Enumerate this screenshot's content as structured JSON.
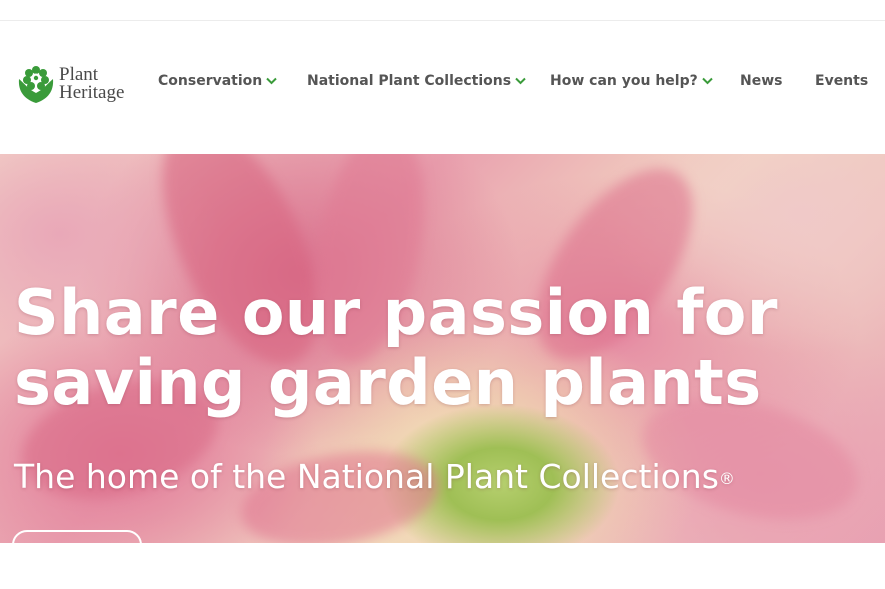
{
  "brand": {
    "name_line1": "Plant",
    "name_line2": "Heritage",
    "green": "#3a9b3a",
    "logo_icon": "flower-hands-icon"
  },
  "nav": {
    "items": [
      {
        "label": "Conservation",
        "has_dropdown": true
      },
      {
        "label": "National Plant Collections",
        "has_dropdown": true
      },
      {
        "label": "How can you help?",
        "has_dropdown": true
      },
      {
        "label": "News",
        "has_dropdown": false
      },
      {
        "label": "Events",
        "has_dropdown": false
      }
    ],
    "dropdown_icon": "chevron-down-icon",
    "chevron_color": "#3a9b3a"
  },
  "hero": {
    "title_line1": "Share our passion for",
    "title_line2": "saving garden plants",
    "subtitle": "The home of the National Plant Collections",
    "subtitle_mark": "®"
  }
}
